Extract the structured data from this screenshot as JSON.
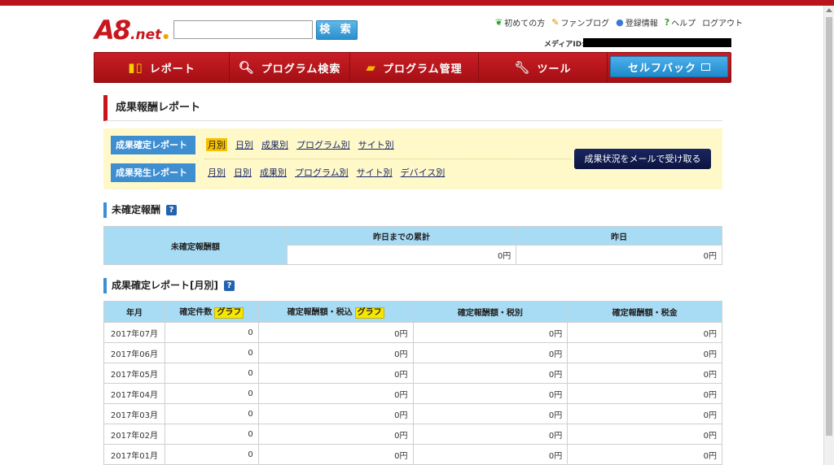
{
  "logo": {
    "a8": "A8",
    "net": ".net"
  },
  "search": {
    "value": "",
    "placeholder": "",
    "button_label": "検 索"
  },
  "toplinks": [
    {
      "label": "初めての方",
      "icon": "leaf-icon"
    },
    {
      "label": "ファンブログ",
      "icon": "pen-icon"
    },
    {
      "label": "登録情報",
      "icon": "user-icon"
    },
    {
      "label": "ヘルプ",
      "icon": "help-icon"
    },
    {
      "label": "ログアウト",
      "icon": ""
    }
  ],
  "media_id_label": "メディアID:",
  "nav": {
    "report": "レポート",
    "program_search": "プログラム検索",
    "program_manage": "プログラム管理",
    "tool": "ツール",
    "selfback": "セルフバック"
  },
  "page_title": "成果報酬レポート",
  "filters": {
    "confirmed_label": "成果確定レポート",
    "occurred_label": "成果発生レポート",
    "confirmed_links": [
      "月別",
      "日別",
      "成果別",
      "プログラム別",
      "サイト別"
    ],
    "occurred_links": [
      "月別",
      "日別",
      "成果別",
      "プログラム別",
      "サイト別",
      "デバイス別"
    ],
    "mail_button": "成果状況をメールで受け取る"
  },
  "unconfirmed": {
    "title": "未確定報酬",
    "row_header": "未確定報酬額",
    "col_cumulative": "昨日までの累計",
    "col_yesterday": "昨日",
    "cumulative_value": "0円",
    "yesterday_value": "0円"
  },
  "monthly": {
    "title": "成果確定レポート[月別]",
    "headers": {
      "ym": "年月",
      "count": "確定件数",
      "tax_in": "確定報酬額・税込",
      "tax_ex": "確定報酬額・税別",
      "tax": "確定報酬額・税金",
      "graph": "グラフ"
    },
    "rows": [
      {
        "ym": "2017年07月",
        "count": "0",
        "tax_in": "0円",
        "tax_ex": "0円",
        "tax": "0円"
      },
      {
        "ym": "2017年06月",
        "count": "0",
        "tax_in": "0円",
        "tax_ex": "0円",
        "tax": "0円"
      },
      {
        "ym": "2017年05月",
        "count": "0",
        "tax_in": "0円",
        "tax_ex": "0円",
        "tax": "0円"
      },
      {
        "ym": "2017年04月",
        "count": "0",
        "tax_in": "0円",
        "tax_ex": "0円",
        "tax": "0円"
      },
      {
        "ym": "2017年03月",
        "count": "0",
        "tax_in": "0円",
        "tax_ex": "0円",
        "tax": "0円"
      },
      {
        "ym": "2017年02月",
        "count": "0",
        "tax_in": "0円",
        "tax_ex": "0円",
        "tax": "0円"
      },
      {
        "ym": "2017年01月",
        "count": "0",
        "tax_in": "0円",
        "tax_ex": "0円",
        "tax": "0円"
      }
    ]
  }
}
